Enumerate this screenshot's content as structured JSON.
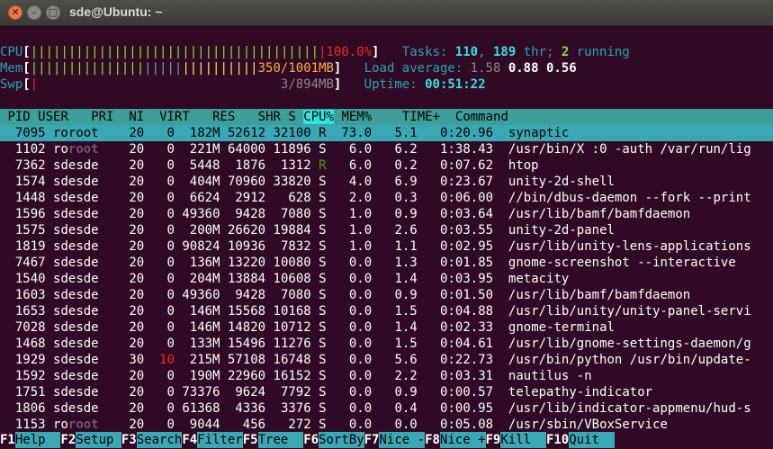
{
  "window": {
    "title": "sde@Ubuntu: ~"
  },
  "meters": {
    "cpu": {
      "label": "CPU",
      "value": "100.0%"
    },
    "mem": {
      "label": "Mem",
      "value": "350/1001MB"
    },
    "swp": {
      "label": "Swp",
      "value": "3/894MB"
    }
  },
  "tasks": {
    "label": "Tasks:",
    "total": "110",
    "threads": "189",
    "thr_label": "thr;",
    "running": "2",
    "running_label": "running"
  },
  "load": {
    "label": "Load average:",
    "v1": "1.58",
    "v5": "0.88",
    "v15": "0.56"
  },
  "uptime": {
    "label": "Uptime:",
    "value": "00:51:22"
  },
  "columns": [
    "PID",
    "USER",
    "PRI",
    "NI",
    "VIRT",
    "RES",
    "SHR",
    "S",
    "CPU%",
    "MEM%",
    "TIME+",
    "Command"
  ],
  "processes": [
    {
      "pid": "7095",
      "user": "root",
      "pri": "20",
      "ni": "0",
      "virt": "182M",
      "res": "52612",
      "shr": "32100",
      "s": "R",
      "cpu": "73.0",
      "mem": "5.1",
      "time": "0:20.96",
      "cmd": "synaptic"
    },
    {
      "pid": "1102",
      "user": "root",
      "pri": "20",
      "ni": "0",
      "virt": "221M",
      "res": "64000",
      "shr": "11896",
      "s": "S",
      "cpu": "6.0",
      "mem": "6.2",
      "time": "1:38.43",
      "cmd": "/usr/bin/X :0 -auth /var/run/lig"
    },
    {
      "pid": "7362",
      "user": "sde",
      "pri": "20",
      "ni": "0",
      "virt": "5448",
      "res": "1876",
      "shr": "1312",
      "s": "R",
      "cpu": "6.0",
      "mem": "0.2",
      "time": "0:07.62",
      "cmd": "htop"
    },
    {
      "pid": "1574",
      "user": "sde",
      "pri": "20",
      "ni": "0",
      "virt": "404M",
      "res": "70960",
      "shr": "33820",
      "s": "S",
      "cpu": "4.0",
      "mem": "6.9",
      "time": "0:23.67",
      "cmd": "unity-2d-shell"
    },
    {
      "pid": "1448",
      "user": "sde",
      "pri": "20",
      "ni": "0",
      "virt": "6624",
      "res": "2912",
      "shr": "628",
      "s": "S",
      "cpu": "2.0",
      "mem": "0.3",
      "time": "0:06.00",
      "cmd": "//bin/dbus-daemon --fork --print"
    },
    {
      "pid": "1596",
      "user": "sde",
      "pri": "20",
      "ni": "0",
      "virt": "49360",
      "res": "9428",
      "shr": "7080",
      "s": "S",
      "cpu": "1.0",
      "mem": "0.9",
      "time": "0:03.64",
      "cmd": "/usr/lib/bamf/bamfdaemon"
    },
    {
      "pid": "1575",
      "user": "sde",
      "pri": "20",
      "ni": "0",
      "virt": "200M",
      "res": "26620",
      "shr": "19884",
      "s": "S",
      "cpu": "1.0",
      "mem": "2.6",
      "time": "0:03.55",
      "cmd": "unity-2d-panel"
    },
    {
      "pid": "1819",
      "user": "sde",
      "pri": "20",
      "ni": "0",
      "virt": "90824",
      "res": "10936",
      "shr": "7832",
      "s": "S",
      "cpu": "1.0",
      "mem": "1.1",
      "time": "0:02.95",
      "cmd": "/usr/lib/unity-lens-applications"
    },
    {
      "pid": "7467",
      "user": "sde",
      "pri": "20",
      "ni": "0",
      "virt": "136M",
      "res": "13220",
      "shr": "10080",
      "s": "S",
      "cpu": "0.0",
      "mem": "1.3",
      "time": "0:01.85",
      "cmd": "gnome-screenshot --interactive"
    },
    {
      "pid": "1540",
      "user": "sde",
      "pri": "20",
      "ni": "0",
      "virt": "204M",
      "res": "13884",
      "shr": "10608",
      "s": "S",
      "cpu": "0.0",
      "mem": "1.4",
      "time": "0:03.95",
      "cmd": "metacity"
    },
    {
      "pid": "1603",
      "user": "sde",
      "pri": "20",
      "ni": "0",
      "virt": "49360",
      "res": "9428",
      "shr": "7080",
      "s": "S",
      "cpu": "0.0",
      "mem": "0.9",
      "time": "0:01.50",
      "cmd": "/usr/lib/bamf/bamfdaemon"
    },
    {
      "pid": "1653",
      "user": "sde",
      "pri": "20",
      "ni": "0",
      "virt": "146M",
      "res": "15568",
      "shr": "10168",
      "s": "S",
      "cpu": "0.0",
      "mem": "1.5",
      "time": "0:04.88",
      "cmd": "/usr/lib/unity/unity-panel-servi"
    },
    {
      "pid": "7028",
      "user": "sde",
      "pri": "20",
      "ni": "0",
      "virt": "146M",
      "res": "14820",
      "shr": "10712",
      "s": "S",
      "cpu": "0.0",
      "mem": "1.4",
      "time": "0:02.33",
      "cmd": "gnome-terminal"
    },
    {
      "pid": "1468",
      "user": "sde",
      "pri": "20",
      "ni": "0",
      "virt": "133M",
      "res": "15496",
      "shr": "11276",
      "s": "S",
      "cpu": "0.0",
      "mem": "1.5",
      "time": "0:04.61",
      "cmd": "/usr/lib/gnome-settings-daemon/g"
    },
    {
      "pid": "1929",
      "user": "sde",
      "pri": "30",
      "ni": "10",
      "virt": "215M",
      "res": "57108",
      "shr": "16748",
      "s": "S",
      "cpu": "0.0",
      "mem": "5.6",
      "time": "0:22.73",
      "cmd": "/usr/bin/python /usr/bin/update-"
    },
    {
      "pid": "1592",
      "user": "sde",
      "pri": "20",
      "ni": "0",
      "virt": "190M",
      "res": "22960",
      "shr": "16152",
      "s": "S",
      "cpu": "0.0",
      "mem": "2.2",
      "time": "0:03.31",
      "cmd": "nautilus -n"
    },
    {
      "pid": "1751",
      "user": "sde",
      "pri": "20",
      "ni": "0",
      "virt": "73376",
      "res": "9624",
      "shr": "7792",
      "s": "S",
      "cpu": "0.0",
      "mem": "0.9",
      "time": "0:00.57",
      "cmd": "telepathy-indicator"
    },
    {
      "pid": "1806",
      "user": "sde",
      "pri": "20",
      "ni": "0",
      "virt": "61368",
      "res": "4336",
      "shr": "3376",
      "s": "S",
      "cpu": "0.0",
      "mem": "0.4",
      "time": "0:00.95",
      "cmd": "/usr/lib/indicator-appmenu/hud-s"
    },
    {
      "pid": "1153",
      "user": "root",
      "pri": "20",
      "ni": "0",
      "virt": "9044",
      "res": "456",
      "shr": "272",
      "s": "S",
      "cpu": "0.0",
      "mem": "0.0",
      "time": "0:05.08",
      "cmd": "/usr/sbin/VBoxService"
    }
  ],
  "function_keys": [
    {
      "key": "F1",
      "label": "Help"
    },
    {
      "key": "F2",
      "label": "Setup"
    },
    {
      "key": "F3",
      "label": "Search"
    },
    {
      "key": "F4",
      "label": "Filter"
    },
    {
      "key": "F5",
      "label": "Tree"
    },
    {
      "key": "F6",
      "label": "SortBy"
    },
    {
      "key": "F7",
      "label": "Nice -"
    },
    {
      "key": "F8",
      "label": "Nice +"
    },
    {
      "key": "F9",
      "label": "Kill"
    },
    {
      "key": "F10",
      "label": "Quit"
    }
  ]
}
